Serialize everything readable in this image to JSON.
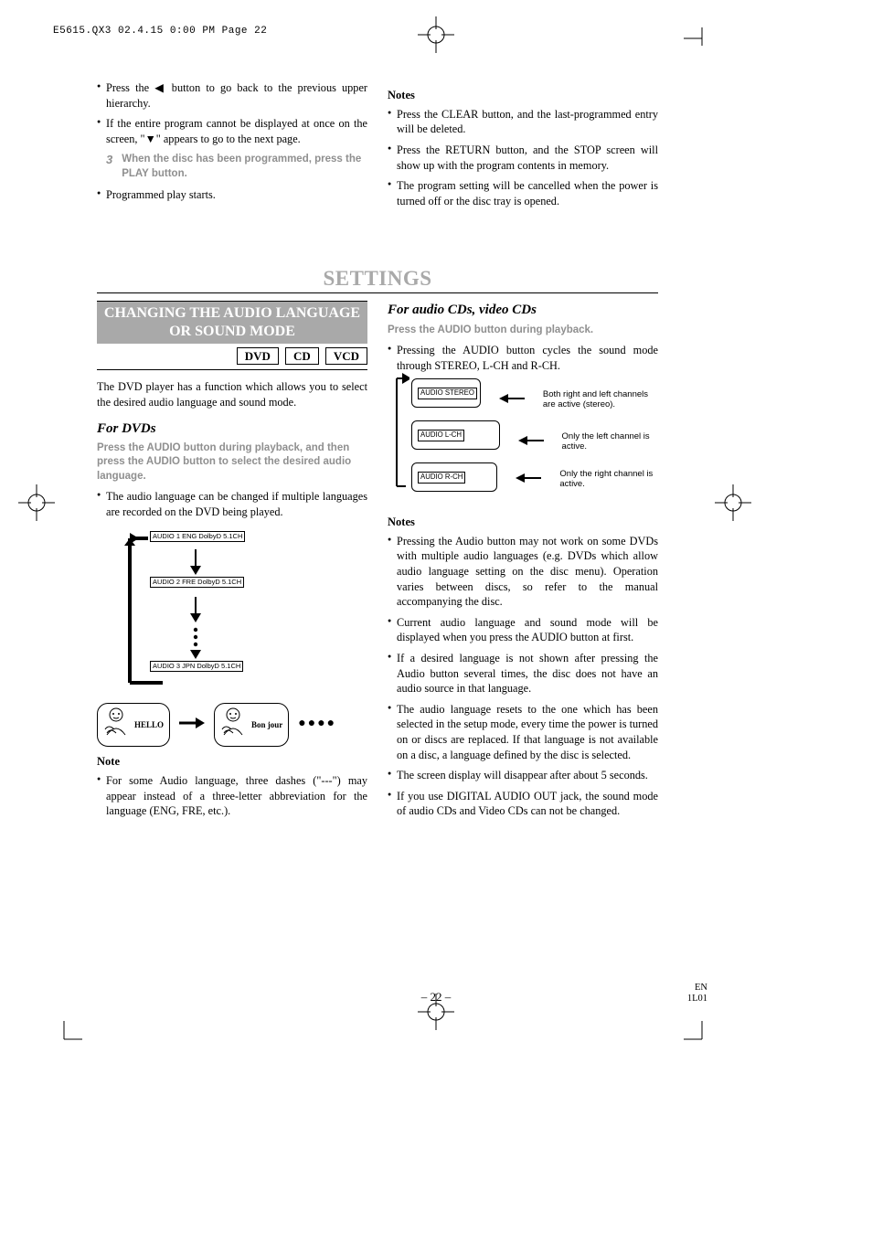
{
  "header": "E5615.QX3  02.4.15 0:00 PM  Page 22",
  "top": {
    "left": {
      "bullets": [
        "Press the ◀ button to go back to the previous upper hierarchy.",
        "If the entire program cannot be displayed at once on the screen, \"▼\" appears to go to the next page."
      ],
      "step_num": "3",
      "step_text": "When the disc has been programmed, press the PLAY button.",
      "after": [
        "Programmed play starts."
      ]
    },
    "right": {
      "heading": "Notes",
      "bullets": [
        "Press the CLEAR button, and the last-programmed entry will be deleted.",
        "Press the RETURN button, and the STOP screen will show up with the program contents in memory.",
        "The program setting will be cancelled when the power is turned off or the disc tray is opened."
      ]
    }
  },
  "section_title": "SETTINGS",
  "left": {
    "banner": "CHANGING THE AUDIO LANGUAGE OR SOUND MODE",
    "discs": [
      "DVD",
      "CD",
      "VCD"
    ],
    "intro": "The DVD player has a function which allows you to select the desired audio language and sound mode.",
    "sub": "For DVDs",
    "grey": "Press the AUDIO button during playback, and then press the AUDIO button to select the desired audio language.",
    "bullet1": "The audio language can be changed if multiple languages are recorded on the DVD being played.",
    "osd": [
      "AUDIO 1 ENG DolbyD 5.1CH",
      "AUDIO 2 FRE DolbyD 5.1CH",
      "AUDIO 3 JPN DolbyD 5.1CH"
    ],
    "bubbles": [
      "HELLO",
      "Bon jour"
    ],
    "note_hd": "Note",
    "note": "For some Audio language, three dashes (\"---\") may appear instead of a three-letter abbreviation for the language (ENG, FRE, etc.)."
  },
  "right": {
    "sub": "For audio CDs, video CDs",
    "grey": "Press the AUDIO button during playback.",
    "bullet1": "Pressing the AUDIO button cycles the sound mode through STEREO, L-CH and R-CH.",
    "screens": [
      {
        "label": "AUDIO STEREO",
        "cap": "Both right and left channels are active (stereo)."
      },
      {
        "label": "AUDIO L-CH",
        "cap": "Only the left channel is active."
      },
      {
        "label": "AUDIO R-CH",
        "cap": "Only the right channel is active."
      }
    ],
    "notes_hd": "Notes",
    "notes": [
      "Pressing the Audio button may not work on some DVDs with multiple audio languages (e.g. DVDs which allow audio language setting on the disc menu). Operation varies between discs, so refer to the manual accompanying the disc.",
      "Current audio language and sound mode will be displayed when you press the AUDIO button at first.",
      "If a desired language is not shown after pressing the Audio button several times, the disc does not have an audio source in that language.",
      "The audio language resets to the one which has been selected in the setup mode, every time the power is turned on or discs are replaced. If that language is not available on a disc, a language defined by the disc is selected.",
      "The screen display will disappear after about 5 seconds.",
      "If you use DIGITAL AUDIO OUT jack, the sound mode of audio CDs and Video CDs can not be changed."
    ]
  },
  "page_num": "– 22 –",
  "ref": {
    "a": "EN",
    "b": "1L01"
  }
}
